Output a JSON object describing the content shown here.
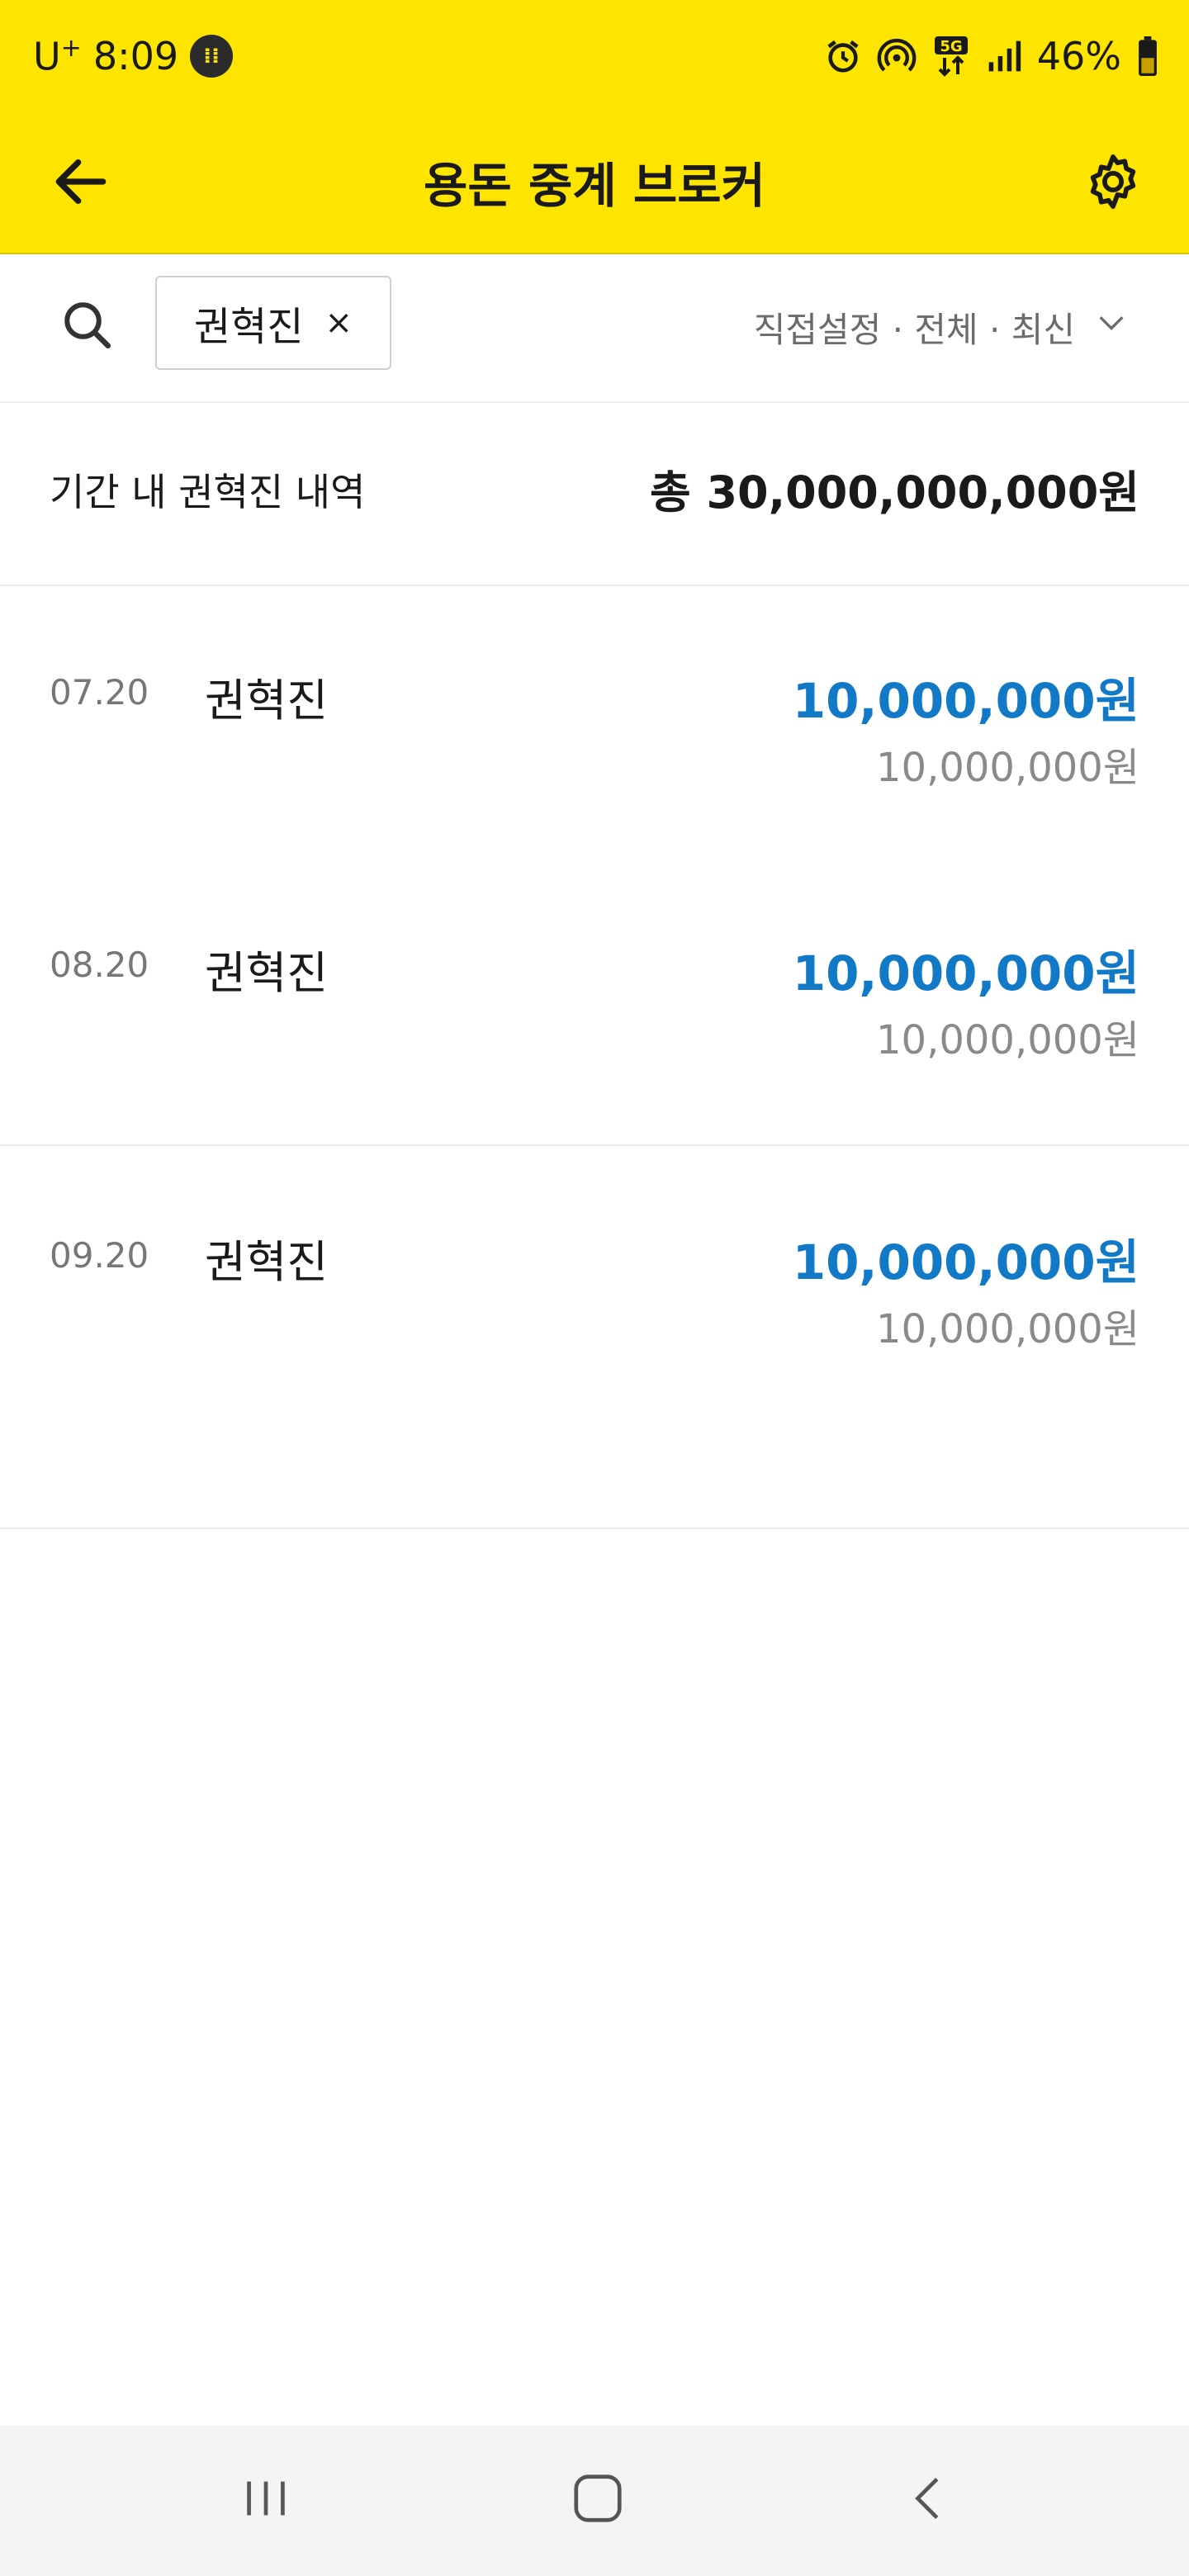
{
  "status_bar": {
    "carrier": "U",
    "carrier_sup": "+",
    "time": "8:09",
    "battery": "46%",
    "network": "5G"
  },
  "app_bar": {
    "title": "용돈 중계 브로커"
  },
  "filter": {
    "chip_label": "권혁진",
    "chip_close": "×",
    "options": "직접설정 · 전체 · 최신"
  },
  "summary": {
    "label": "기간 내 권혁진 내역",
    "total": "총 30,000,000,000원"
  },
  "transactions": [
    {
      "date": "07.20",
      "name": "권혁진",
      "amount": "10,000,000원",
      "balance": "10,000,000원"
    },
    {
      "date": "08.20",
      "name": "권혁진",
      "amount": "10,000,000원",
      "balance": "10,000,000원"
    },
    {
      "date": "09.20",
      "name": "권혁진",
      "amount": "10,000,000원",
      "balance": "10,000,000원"
    }
  ],
  "colors": {
    "brand_yellow": "#FEE500",
    "amount_blue": "#1279c7"
  },
  "icons": [
    "back-arrow-icon",
    "gear-icon",
    "search-icon",
    "chevron-down-icon",
    "recents-icon",
    "home-icon",
    "nav-back-icon",
    "alarm-icon",
    "hotspot-icon",
    "signal-icon",
    "battery-icon"
  ]
}
